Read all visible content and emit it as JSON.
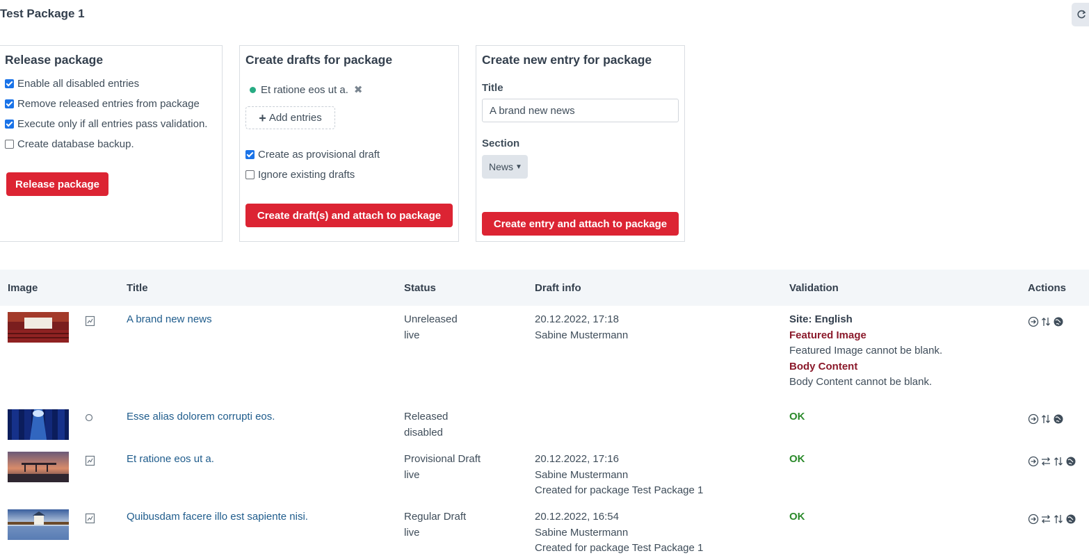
{
  "page": {
    "title": "Test Package 1"
  },
  "release_panel": {
    "heading": "Release package",
    "options": [
      {
        "label": "Enable all disabled entries",
        "checked": true
      },
      {
        "label": "Remove released entries from package",
        "checked": true
      },
      {
        "label": "Execute only if all entries pass validation.",
        "checked": true
      },
      {
        "label": "Create database backup.",
        "checked": false
      }
    ],
    "button_label": "Release package"
  },
  "drafts_panel": {
    "heading": "Create drafts for package",
    "selected_entry": "Et ratione eos ut a.",
    "add_entries_label": "Add entries",
    "options": [
      {
        "label": "Create as provisional draft",
        "checked": true
      },
      {
        "label": "Ignore existing drafts",
        "checked": false
      }
    ],
    "button_label": "Create draft(s) and attach to package"
  },
  "new_entry_panel": {
    "heading": "Create new entry for package",
    "title_label": "Title",
    "title_value": "A brand new news",
    "section_label": "Section",
    "section_value": "News",
    "button_label": "Create entry and attach to package"
  },
  "table": {
    "columns": [
      "Image",
      "Title",
      "Status",
      "Draft info",
      "Validation",
      "Actions"
    ],
    "rows": [
      {
        "title": "A brand new news",
        "status": [
          "Unreleased",
          "live"
        ],
        "draft_info": [
          "20.12.2022, 17:18",
          "Sabine Mustermann"
        ],
        "validation": {
          "site": "Site: English",
          "ok": "",
          "errors": [
            {
              "field": "Featured Image",
              "message": "Featured Image cannot be blank."
            },
            {
              "field": "Body Content",
              "message": "Body Content cannot be blank."
            }
          ]
        },
        "row_icon": "chart-icon",
        "actions": [
          "view-icon",
          "sort-icon",
          "globe-icon"
        ]
      },
      {
        "title": "Esse alias dolorem corrupti eos.",
        "status": [
          "Released",
          "disabled"
        ],
        "draft_info": [],
        "validation": {
          "site": "",
          "ok": "OK",
          "errors": []
        },
        "row_icon": "circle-icon",
        "actions": [
          "view-icon",
          "sort-icon",
          "globe-icon"
        ]
      },
      {
        "title": "Et ratione eos ut a.",
        "status": [
          "Provisional Draft",
          "live"
        ],
        "draft_info": [
          "20.12.2022, 17:16",
          "Sabine Mustermann",
          "Created for package Test Package 1"
        ],
        "validation": {
          "site": "",
          "ok": "OK",
          "errors": []
        },
        "row_icon": "chart-icon",
        "actions": [
          "view-icon",
          "compare-icon",
          "sort-icon",
          "globe-icon"
        ]
      },
      {
        "title": "Quibusdam facere illo est sapiente nisi.",
        "status": [
          "Regular Draft",
          "live"
        ],
        "draft_info": [
          "20.12.2022, 16:54",
          "Sabine Mustermann",
          "Created for package Test Package 1"
        ],
        "validation": {
          "site": "",
          "ok": "OK",
          "errors": []
        },
        "row_icon": "chart-icon",
        "actions": [
          "view-icon",
          "compare-icon",
          "sort-icon",
          "globe-icon"
        ]
      }
    ]
  },
  "colors": {
    "primary_button": "#dc2433",
    "link": "#1f5c8c",
    "ok": "#2b8a2b",
    "error_field": "#8b1a2b",
    "status_dot": "#27ab83"
  }
}
